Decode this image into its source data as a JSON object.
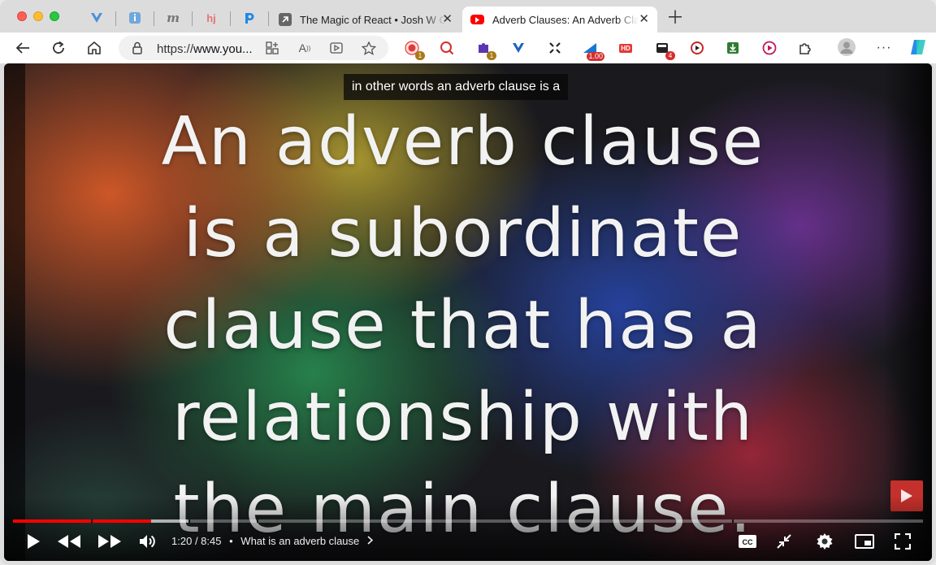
{
  "browser": {
    "tabs": [
      {
        "title": "The Magic of React • Josh W Comeau",
        "active": false
      },
      {
        "title": "Adverb Clauses: An Adverb Clause",
        "active": true
      }
    ],
    "url": {
      "prefix": "https://",
      "host": "www.you..."
    }
  },
  "extensions": [
    {
      "icon": "record-icon",
      "badge": "1",
      "color": "#e53935"
    },
    {
      "icon": "magnifier-icon",
      "badge": "",
      "color": "#d32f2f"
    },
    {
      "icon": "puzzle-purple-icon",
      "badge": "1",
      "color": "#5e35b1"
    },
    {
      "icon": "vue-icon",
      "badge": "",
      "color": "#1565c0"
    },
    {
      "icon": "scatter-icon",
      "badge": "",
      "color": "#222222"
    },
    {
      "icon": "speed-icon",
      "badge": "1.00",
      "color": "#1976d2"
    },
    {
      "icon": "hd-icon",
      "badge": "",
      "color": "#e53935"
    },
    {
      "icon": "cards-icon",
      "badge": "4",
      "color": "#222222"
    },
    {
      "icon": "video-search-icon",
      "badge": "",
      "color": "#c62828"
    },
    {
      "icon": "download-icon",
      "badge": "",
      "color": "#2e7d32"
    },
    {
      "icon": "play-circle-icon",
      "badge": "",
      "color": "#c2185b"
    }
  ],
  "video": {
    "caption": "in other words an adverb clause is a",
    "slide_lines": [
      "An adverb clause",
      "is a subordinate",
      "clause that has a",
      "relationship with",
      "the main clause."
    ],
    "current_time": "1:20",
    "duration": "8:45",
    "chapter": "What is an adverb clause",
    "progress_fraction": 0.152,
    "buffered_fraction": 0.193,
    "accent": "#ff0000"
  }
}
